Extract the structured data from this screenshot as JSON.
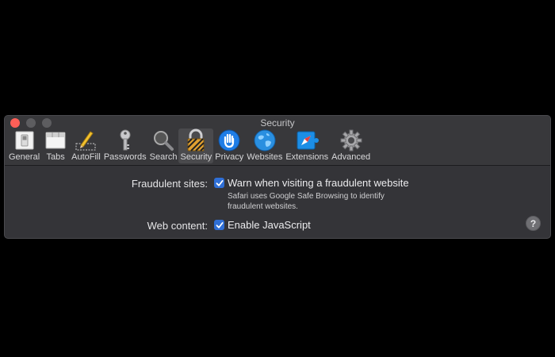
{
  "window": {
    "title": "Security"
  },
  "toolbar": {
    "tabs": [
      {
        "label": "General",
        "icon": "general-switch-icon"
      },
      {
        "label": "Tabs",
        "icon": "tabs-icon"
      },
      {
        "label": "AutoFill",
        "icon": "pencil-icon"
      },
      {
        "label": "Passwords",
        "icon": "key-icon"
      },
      {
        "label": "Search",
        "icon": "magnifier-icon"
      },
      {
        "label": "Security",
        "icon": "lock-icon",
        "selected": true
      },
      {
        "label": "Privacy",
        "icon": "hand-icon"
      },
      {
        "label": "Websites",
        "icon": "globe-icon"
      },
      {
        "label": "Extensions",
        "icon": "puzzle-compass-icon"
      },
      {
        "label": "Advanced",
        "icon": "gear-icon"
      }
    ]
  },
  "settings": {
    "fraudulent": {
      "label": "Fraudulent sites:",
      "option": "Warn when visiting a fraudulent website",
      "checked": true,
      "description": "Safari uses Google Safe Browsing to identify fraudulent websites."
    },
    "web_content": {
      "label": "Web content:",
      "option": "Enable JavaScript",
      "checked": true
    }
  },
  "help": {
    "symbol": "?"
  },
  "colors": {
    "accent": "#2f6fd6",
    "close": "#fe5f57",
    "window_bg": "#343438"
  }
}
